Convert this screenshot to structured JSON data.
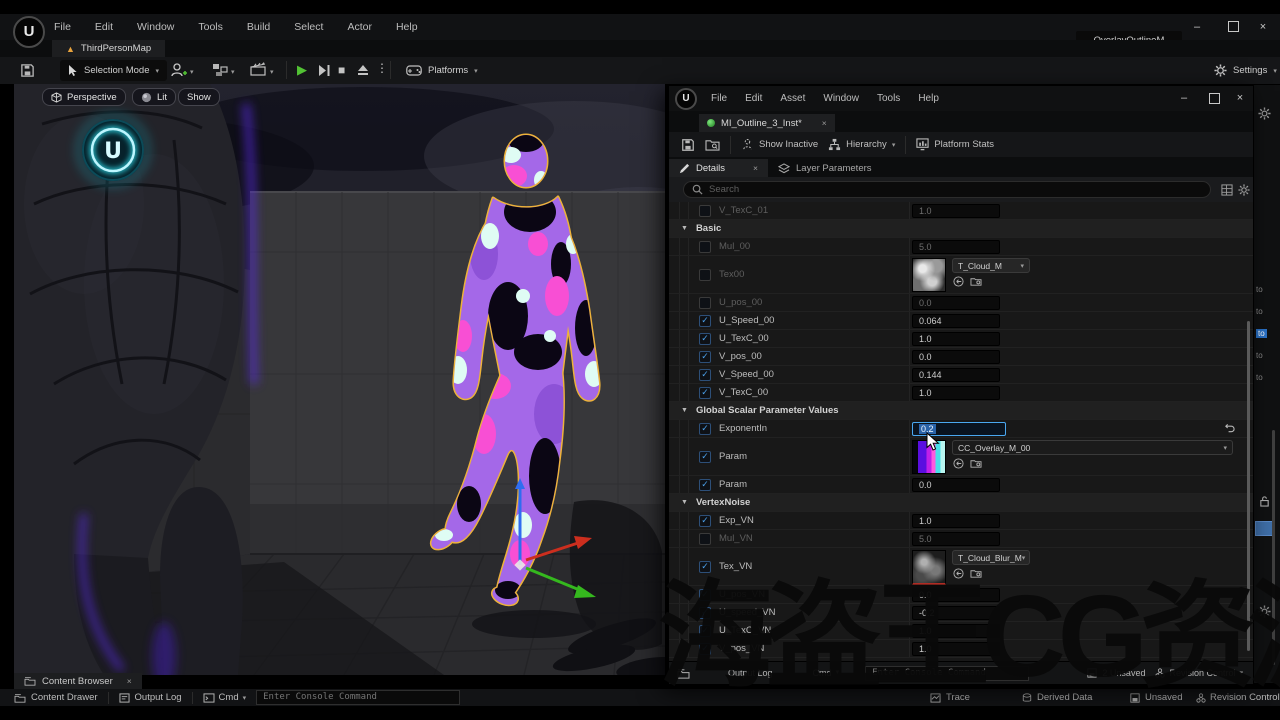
{
  "window": {
    "title": "OverlayOutlineM"
  },
  "main_menu": [
    "File",
    "Edit",
    "Window",
    "Tools",
    "Build",
    "Select",
    "Actor",
    "Help"
  ],
  "level_tab": {
    "label": "ThirdPersonMap"
  },
  "main_toolbar": {
    "selection_mode": "Selection Mode",
    "platforms": "Platforms",
    "settings": "Settings"
  },
  "viewport": {
    "perspective": "Perspective",
    "lit": "Lit",
    "show": "Show"
  },
  "material_editor": {
    "menu": [
      "File",
      "Edit",
      "Asset",
      "Window",
      "Tools",
      "Help"
    ],
    "tab": {
      "label": "MI_Outline_3_Inst*"
    },
    "toolbar": {
      "show_inactive": "Show Inactive",
      "hierarchy": "Hierarchy",
      "platform_stats": "Platform Stats"
    },
    "panel_tabs": {
      "details": "Details",
      "layer_parameters": "Layer Parameters"
    },
    "search": {
      "placeholder": "Search"
    },
    "rows": [
      {
        "kind": "scalar",
        "name": "V_TexC_01",
        "value": "1.0",
        "checked": false
      },
      {
        "kind": "section",
        "name": "Basic"
      },
      {
        "kind": "scalar",
        "name": "Mul_00",
        "value": "5.0",
        "checked": false
      },
      {
        "kind": "texture",
        "name": "Tex00",
        "value": "T_Cloud_M",
        "checked": false,
        "thumb": "gray-cloud",
        "wide": false
      },
      {
        "kind": "scalar",
        "name": "U_pos_00",
        "value": "0.0",
        "checked": false
      },
      {
        "kind": "scalar",
        "name": "U_Speed_00",
        "value": "0.064",
        "checked": true
      },
      {
        "kind": "scalar",
        "name": "U_TexC_00",
        "value": "1.0",
        "checked": true
      },
      {
        "kind": "scalar",
        "name": "V_pos_00",
        "value": "0.0",
        "checked": true
      },
      {
        "kind": "scalar",
        "name": "V_Speed_00",
        "value": "0.144",
        "checked": true
      },
      {
        "kind": "scalar",
        "name": "V_TexC_00",
        "value": "1.0",
        "checked": true
      },
      {
        "kind": "section",
        "name": "Global Scalar Parameter Values"
      },
      {
        "kind": "scalar",
        "name": "ExponentIn",
        "value": "0.2",
        "checked": true,
        "editing": true
      },
      {
        "kind": "texture",
        "name": "Param",
        "value": "CC_Overlay_M_00",
        "checked": true,
        "thumb": "overlay-gradient",
        "wide": true
      },
      {
        "kind": "scalar",
        "name": "Param",
        "value": "0.0",
        "checked": true
      },
      {
        "kind": "section",
        "name": "VertexNoise"
      },
      {
        "kind": "scalar",
        "name": "Exp_VN",
        "value": "1.0",
        "checked": true
      },
      {
        "kind": "scalar",
        "name": "Mul_VN",
        "value": "5.0",
        "checked": false
      },
      {
        "kind": "texture",
        "name": "Tex_VN",
        "value": "T_Cloud_Blur_M",
        "checked": true,
        "thumb": "dark-cloud",
        "wide": false
      },
      {
        "kind": "scalar",
        "name": "U_pos_VN",
        "value": "0.0",
        "checked": true
      },
      {
        "kind": "scalar",
        "name": "U_speed_VN",
        "value": "-0.2",
        "checked": true
      },
      {
        "kind": "scalar",
        "name": "U_TexC_VN",
        "value": "1.0",
        "checked": true
      },
      {
        "kind": "scalar",
        "name": "V_pos_VN",
        "value": "1.0",
        "checked": true
      }
    ],
    "statusbar": {
      "output_log": "Output Log",
      "cmd": "Cmd",
      "console_placeholder": "Enter Console Command",
      "unsaved": "2 Unsaved",
      "revision_control": "Revision Control"
    }
  },
  "bottom_bar": {
    "content_browser": "Content Browser",
    "content_drawer": "Content Drawer",
    "output_log": "Output Log",
    "cmd": "Cmd",
    "console_placeholder": "Enter Console Command",
    "trace": "Trace",
    "derived_data": "Derived Data",
    "unsaved": "Unsaved",
    "revision_control": "Revision Control"
  },
  "right_strip": {
    "items": [
      "to",
      "to",
      "to",
      "to",
      "to"
    ]
  },
  "watermark": {
    "text": "海盗王CG资源"
  },
  "colors": {
    "accent_blue": "#4a9fe8",
    "outline_orange": "#edb23a",
    "overlay_purple": "#a468e8",
    "overlay_magenta": "#ff49d1",
    "overlay_mint": "#d8fbee",
    "glow_cyan": "#35e8f5",
    "play_green": "#52c234",
    "warning_orange": "#e8a33d"
  }
}
